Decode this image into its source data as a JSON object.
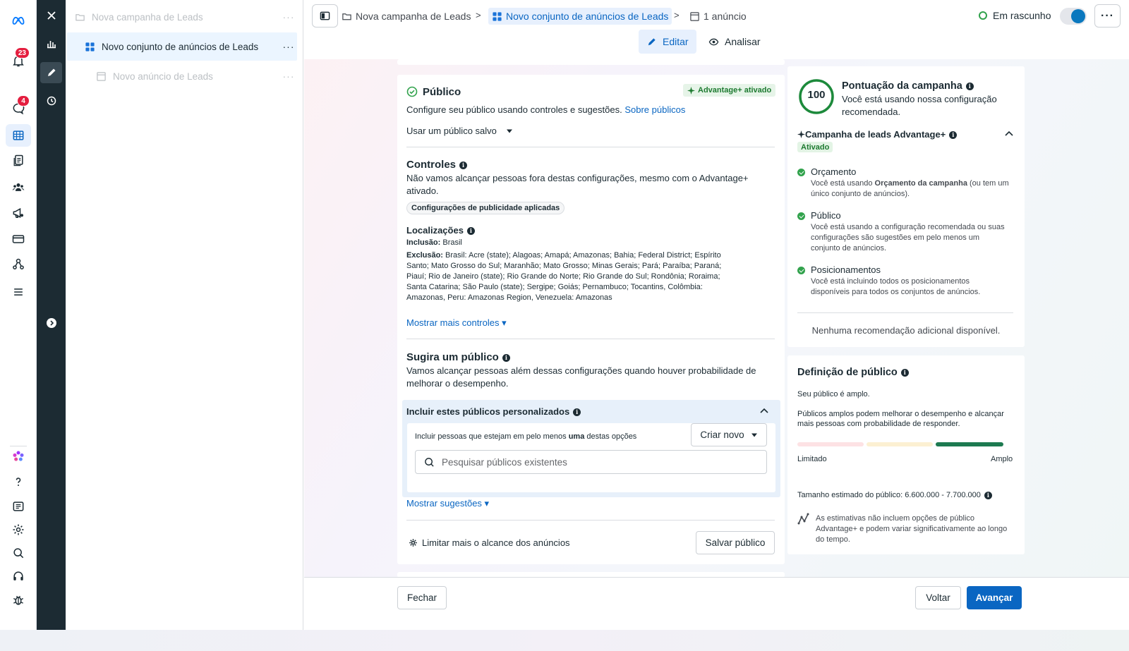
{
  "rail": {
    "notifications_badge": "23",
    "messages_badge": "4"
  },
  "tree": {
    "campaign": "Nova campanha de Leads",
    "adset": "Novo conjunto de anúncios de Leads",
    "ad": "Novo anúncio de Leads",
    "more": "···"
  },
  "topbar": {
    "crumbs": [
      "Nova campanha de Leads",
      "Novo conjunto de anúncios de Leads",
      "1 anúncio"
    ],
    "separator": ">",
    "status": "Em rascunho",
    "more": "···",
    "edit": "Editar",
    "review": "Analisar"
  },
  "audience": {
    "title": "Público",
    "advantage_badge": "Advantage+ ativado",
    "intro": "Configure seu público usando controles e sugestões.",
    "intro_link": "Sobre públicos",
    "saved_audience": "Usar um público salvo",
    "controls_title": "Controles",
    "controls_desc_1": "Não vamos alcançar pessoas fora destas configurações, mesmo com o Advantage+",
    "controls_desc_2": "ativado.",
    "chip": "Configurações de publicidade aplicadas",
    "locations_title": "Localizações",
    "inclusion_label": "Inclusão:",
    "inclusion_value": "Brasil",
    "exclusion_label": "Exclusão:",
    "exclusion_lines": [
      "Brasil: Acre (state); Alagoas; Amapá; Amazonas; Bahia; Federal District; Espírito",
      "Santo; Mato Grosso do Sul; Maranhão; Mato Grosso; Minas Gerais; Pará; Paraíba; Paraná;",
      "Piauí; Rio de Janeiro (state); Rio Grande do Norte; Rio Grande do Sul; Rondônia; Roraima;",
      "Santa Catarina; São Paulo (state); Sergipe; Goiás; Pernambuco; Tocantins, Colômbia:",
      "Amazonas, Peru: Amazonas Region, Venezuela: Amazonas"
    ],
    "show_more_controls": "Mostrar mais controles ▾",
    "suggest_title": "Sugira um público",
    "suggest_desc_1": "Vamos alcançar pessoas além dessas configurações quando houver probabilidade de",
    "suggest_desc_2": "melhorar o desempenho.",
    "include_title": "Incluir estes públicos personalizados",
    "include_desc_pre": "Incluir pessoas que estejam em pelo menos",
    "include_desc_bold": "uma",
    "include_desc_post": "destas opções",
    "create_new": "Criar novo",
    "search_placeholder": "Pesquisar públicos existentes",
    "show_suggestions": "Mostrar sugestões ▾",
    "limit_reach": "Limitar mais o alcance dos anúncios",
    "save_audience": "Salvar público"
  },
  "score": {
    "value": "100",
    "value_fraction": 1.0,
    "title": "Pontuação da campanha",
    "desc_1": "Você está usando nossa configuração",
    "desc_2": "recomendada.",
    "adv_title": "Campanha de leads Advantage+",
    "adv_status": "Ativado",
    "items": [
      {
        "title": "Orçamento",
        "l1_pre": "Você está usando ",
        "l1_bold": "Orçamento da campanha",
        "l1_post": " (ou tem um",
        "l2": "único conjunto de anúncios)."
      },
      {
        "title": "Público",
        "l1": "Você está usando a configuração recomendada ou suas",
        "l2": "configurações são sugestões em pelo menos um",
        "l3": "conjunto de anúncios."
      },
      {
        "title": "Posicionamentos",
        "l1": "Você está incluindo todos os posicionamentos",
        "l2": "disponíveis para todos os conjuntos de anúncios."
      }
    ],
    "no_more": "Nenhuma recomendação adicional disponível."
  },
  "definition": {
    "title": "Definição de público",
    "status": "Seu público é amplo.",
    "desc_1": "Públicos amplos podem melhorar o desempenho e alcançar",
    "desc_2": "mais pessoas com probabilidade de responder.",
    "min_label": "Limitado",
    "max_label": "Amplo",
    "level": "Amplo",
    "size": "Tamanho estimado do público: 6.600.000 - 7.700.000",
    "note_1": "As estimativas não incluem opções de público",
    "note_2": "Advantage+ e podem variar significativamente ao longo",
    "note_3": "do tempo."
  },
  "footer": {
    "close": "Fechar",
    "back": "Voltar",
    "next": "Avançar"
  },
  "colors": {
    "accent": "#0a66c2",
    "success": "#31a24c",
    "dark_nav": "#1c2b33"
  }
}
